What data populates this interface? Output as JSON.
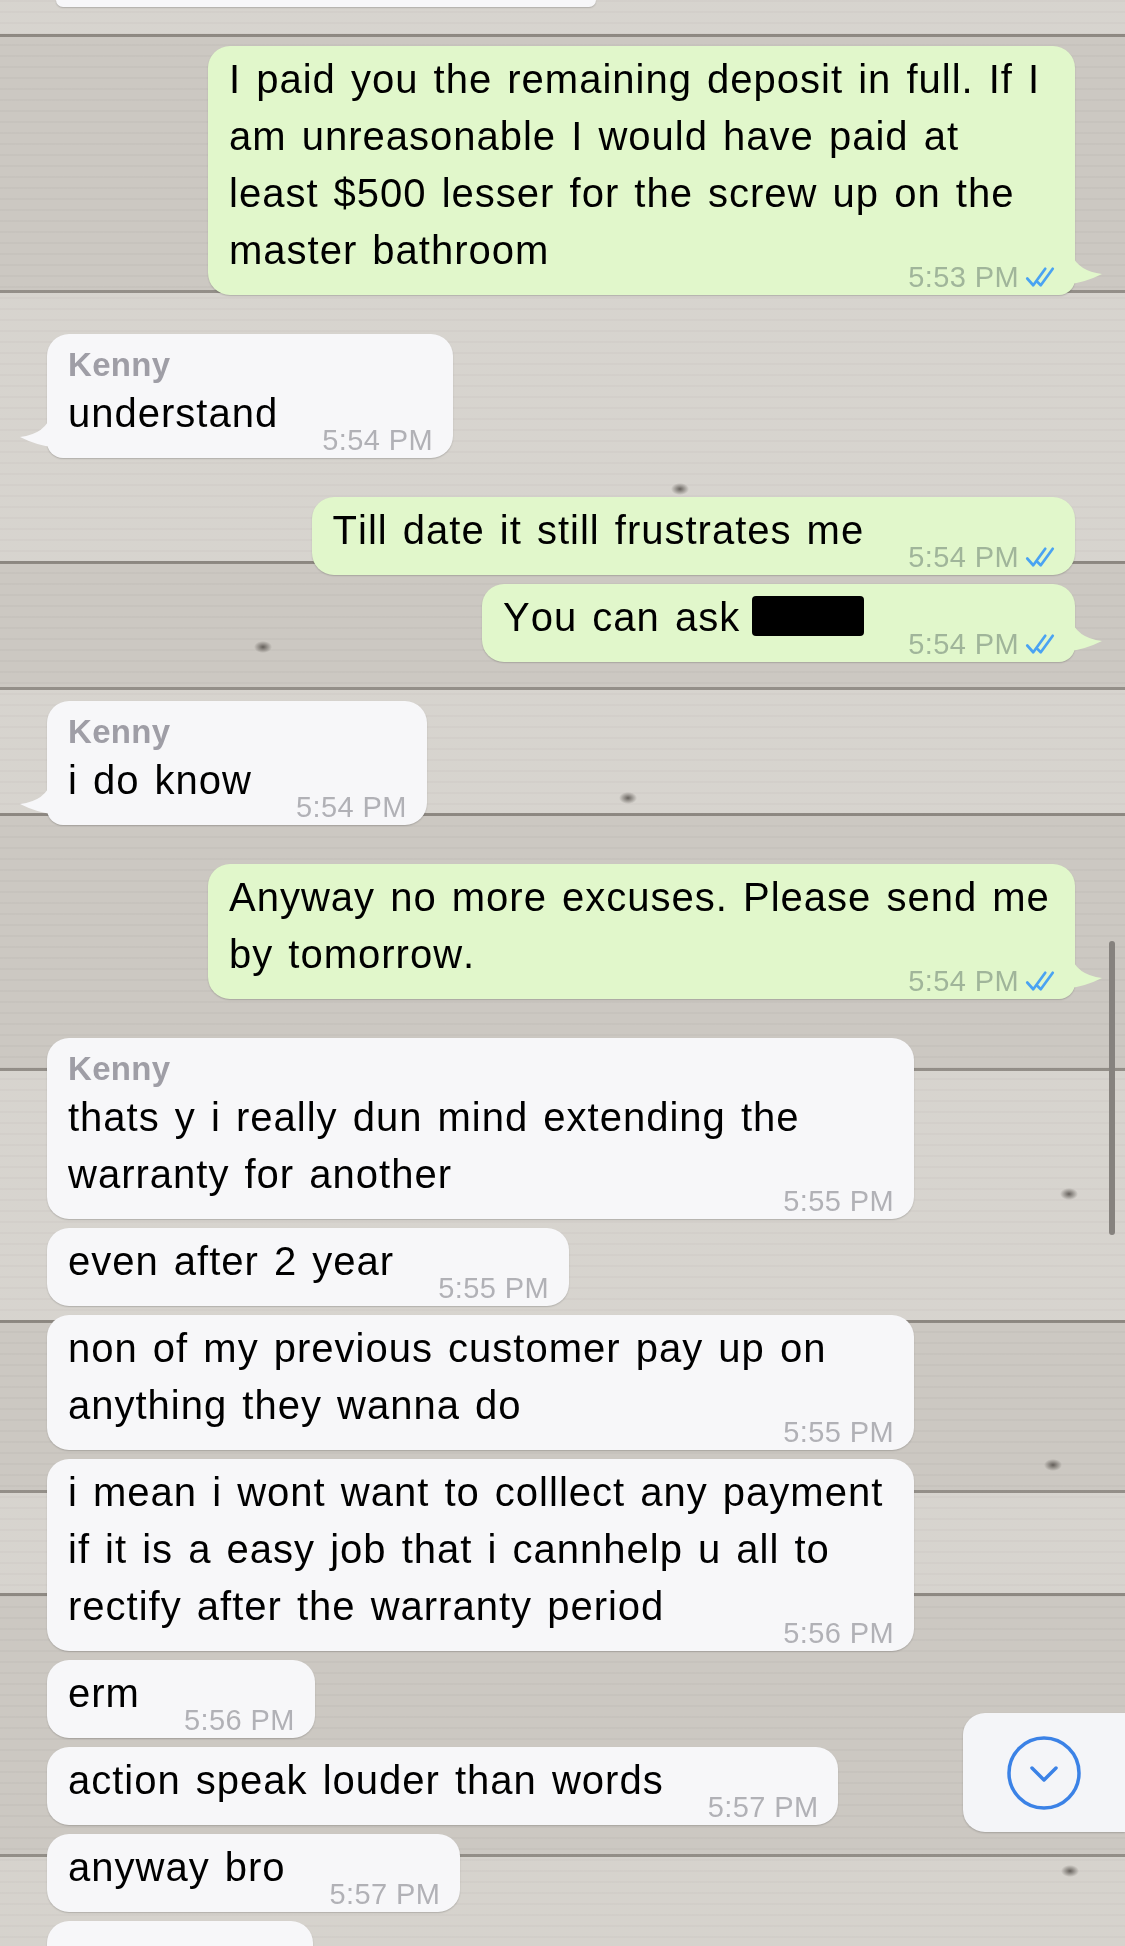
{
  "clipped_top": {
    "kind": "received"
  },
  "messages": [
    {
      "kind": "sent",
      "text": "I paid you the remaining deposit in full. If I am unreasonable I would have paid at least $500 lesser for the screw up on the master bathroom",
      "redacted": false,
      "time": "5:53 PM",
      "read": true,
      "tail": true
    },
    {
      "kind": "received",
      "sender": "Kenny",
      "text": "understand",
      "redacted": false,
      "time": "5:54 PM",
      "tail": true
    },
    {
      "kind": "sent",
      "text": "Till date it still frustrates me",
      "redacted": false,
      "time": "5:54 PM",
      "read": true,
      "tail": false
    },
    {
      "kind": "sent",
      "text": "You can ask",
      "redacted": true,
      "time": "5:54 PM",
      "read": true,
      "tail": true
    },
    {
      "kind": "received",
      "sender": "Kenny",
      "text": "i do know",
      "redacted": false,
      "time": "5:54 PM",
      "tail": true
    },
    {
      "kind": "sent",
      "text": "Anyway no more excuses. Please send me by tomorrow.",
      "redacted": false,
      "time": "5:54 PM",
      "read": true,
      "tail": true
    },
    {
      "kind": "received",
      "sender": "Kenny",
      "text": "thats y i really dun mind extending the warranty for another",
      "redacted": false,
      "time": "5:55 PM",
      "tail": false
    },
    {
      "kind": "received",
      "text": "even after 2 year",
      "redacted": false,
      "time": "5:55 PM",
      "tail": false
    },
    {
      "kind": "received",
      "text": "non of my previous customer pay up on anything they wanna do",
      "redacted": false,
      "time": "5:55 PM",
      "tail": false
    },
    {
      "kind": "received",
      "text": "i mean i wont want to colllect any payment if it is a easy job that i cannhelp u all to rectify after the warranty period",
      "redacted": false,
      "time": "5:56 PM",
      "tail": false
    },
    {
      "kind": "received",
      "text": "erm",
      "redacted": false,
      "time": "5:56 PM",
      "tail": false
    },
    {
      "kind": "received",
      "text": "action speak louder than words",
      "redacted": false,
      "time": "5:57 PM",
      "tail": false
    },
    {
      "kind": "received",
      "text": "anyway bro",
      "redacted": false,
      "time": "5:57 PM",
      "tail": false
    }
  ],
  "clipped_bottom": {
    "kind": "received"
  }
}
